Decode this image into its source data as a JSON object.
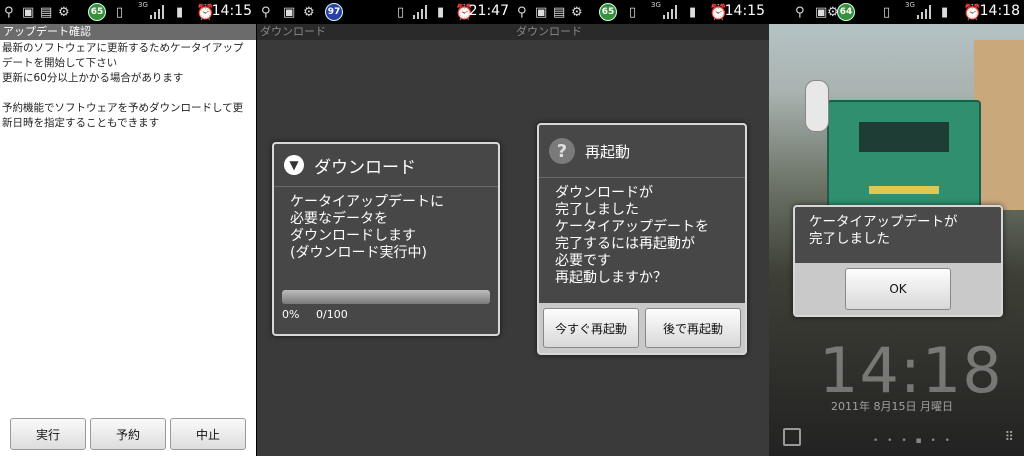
{
  "panels": [
    {
      "status": {
        "battery": "65",
        "time": "14:15"
      }
    },
    {
      "status": {
        "battery": "97",
        "time": "21:47"
      }
    },
    {
      "status": {
        "battery": "65",
        "time": "14:15"
      }
    },
    {
      "status": {
        "battery": "64",
        "time": "14:18"
      }
    }
  ],
  "confirm": {
    "title": "アップデート確認",
    "body": "最新のソフトウェアに更新するためケータイアップデートを開始して下さい\n更新に60分以上かかる場合があります\n\n予約機能でソフトウェアを予めダウンロードして更新日時を指定することもできます",
    "buttons": {
      "run": "実行",
      "reserve": "予約",
      "stop": "中止"
    }
  },
  "download": {
    "titlebar": "ダウンロード",
    "dialog_title": "ダウンロード",
    "message": "ケータイアップデートに\n必要なデータを\nダウンロードします\n(ダウンロード実行中)",
    "progress_fraction": 0,
    "percent": "0%",
    "count": "0/100"
  },
  "restart": {
    "titlebar": "ダウンロード",
    "dialog_title": "再起動",
    "message": "ダウンロードが\n完了しました\nケータイアップデートを\n完了するには再起動が\n必要です\n再起動しますか？",
    "buttons": {
      "now": "今すぐ再起動",
      "later": "後で再起動"
    }
  },
  "complete": {
    "message": "ケータイアップデートが\n完了しました",
    "ok": "OK",
    "clock": "14:18",
    "date": "2011年 8月15日 月曜日"
  },
  "colors": {
    "progress": "#6fb42b",
    "battery_green": "#3a8f3a",
    "battery_blue": "#2b3fa8"
  }
}
